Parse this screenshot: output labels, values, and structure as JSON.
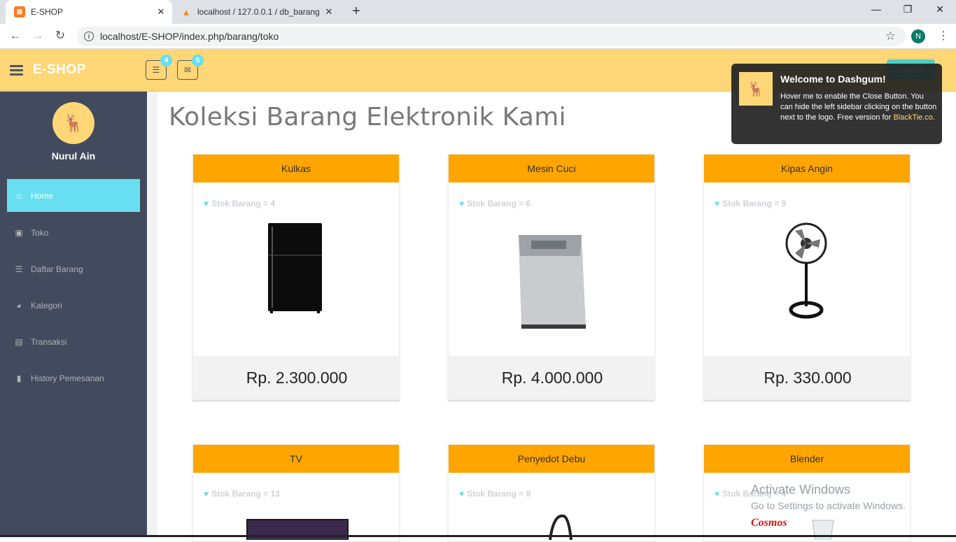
{
  "browser": {
    "tabs": [
      {
        "title": "E-SHOP",
        "icon": "xampp-icon"
      },
      {
        "title": "localhost / 127.0.0.1 / db_barang",
        "icon": "phpmyadmin-icon"
      }
    ],
    "url": "localhost/E-SHOP/index.php/barang/toko",
    "profile_initial": "N"
  },
  "header": {
    "logo": "E-SHOP",
    "tasks_badge": "4",
    "mail_badge": "5",
    "logout_label": "Logout"
  },
  "sidebar": {
    "username": "Nurul Ain",
    "items": [
      {
        "label": "Home",
        "icon": "home-icon",
        "active": true
      },
      {
        "label": "Toko",
        "icon": "briefcase-icon"
      },
      {
        "label": "Daftar Barang",
        "icon": "list-icon"
      },
      {
        "label": "Kategori",
        "icon": "dashboard-icon"
      },
      {
        "label": "Transaksi",
        "icon": "money-icon"
      },
      {
        "label": "History Pemesanan",
        "icon": "bookmark-icon"
      }
    ]
  },
  "main": {
    "title": "Koleksi Barang Elektronik Kami",
    "products": [
      {
        "name": "Kulkas",
        "stok": "Stok Barang = 4",
        "price": "Rp. 2.300.000"
      },
      {
        "name": "Mesin Cuci",
        "stok": "Stok Barang = 6",
        "price": "Rp. 4.000.000"
      },
      {
        "name": "Kipas Angin",
        "stok": "Stok Barang = 9",
        "price": "Rp. 330.000"
      },
      {
        "name": "TV",
        "stok": "Stok Barang = 13",
        "price": ""
      },
      {
        "name": "Penyedot Debu",
        "stok": "Stok Barang = 9",
        "price": ""
      },
      {
        "name": "Blender",
        "stok": "Stok Barang = 4",
        "price": ""
      }
    ]
  },
  "toast": {
    "title": "Welcome to Dashgum!",
    "body": "Hover me to enable the Close Button. You can hide the left sidebar clicking on the button next to the logo. Free version for",
    "link": "BlackTie.co",
    "suffix": "."
  },
  "watermark": {
    "line1": "Activate Windows",
    "line2": "Go to Settings to activate Windows."
  }
}
